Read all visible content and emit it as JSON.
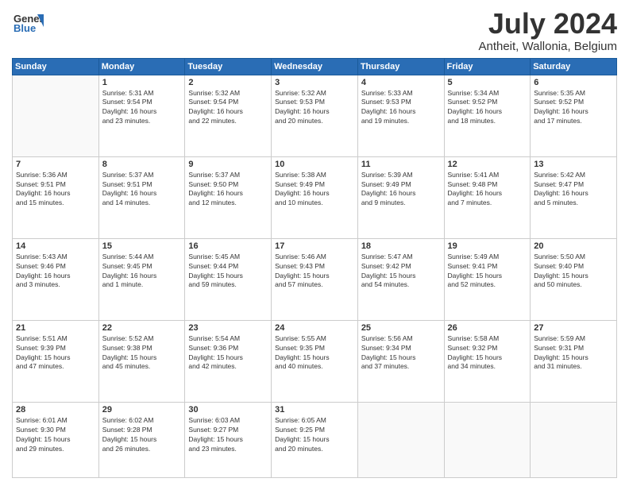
{
  "header": {
    "logo_line1": "General",
    "logo_line2": "Blue",
    "title": "July 2024",
    "subtitle": "Antheit, Wallonia, Belgium"
  },
  "weekdays": [
    "Sunday",
    "Monday",
    "Tuesday",
    "Wednesday",
    "Thursday",
    "Friday",
    "Saturday"
  ],
  "weeks": [
    [
      {
        "day": "",
        "info": ""
      },
      {
        "day": "1",
        "info": "Sunrise: 5:31 AM\nSunset: 9:54 PM\nDaylight: 16 hours\nand 23 minutes."
      },
      {
        "day": "2",
        "info": "Sunrise: 5:32 AM\nSunset: 9:54 PM\nDaylight: 16 hours\nand 22 minutes."
      },
      {
        "day": "3",
        "info": "Sunrise: 5:32 AM\nSunset: 9:53 PM\nDaylight: 16 hours\nand 20 minutes."
      },
      {
        "day": "4",
        "info": "Sunrise: 5:33 AM\nSunset: 9:53 PM\nDaylight: 16 hours\nand 19 minutes."
      },
      {
        "day": "5",
        "info": "Sunrise: 5:34 AM\nSunset: 9:52 PM\nDaylight: 16 hours\nand 18 minutes."
      },
      {
        "day": "6",
        "info": "Sunrise: 5:35 AM\nSunset: 9:52 PM\nDaylight: 16 hours\nand 17 minutes."
      }
    ],
    [
      {
        "day": "7",
        "info": "Sunrise: 5:36 AM\nSunset: 9:51 PM\nDaylight: 16 hours\nand 15 minutes."
      },
      {
        "day": "8",
        "info": "Sunrise: 5:37 AM\nSunset: 9:51 PM\nDaylight: 16 hours\nand 14 minutes."
      },
      {
        "day": "9",
        "info": "Sunrise: 5:37 AM\nSunset: 9:50 PM\nDaylight: 16 hours\nand 12 minutes."
      },
      {
        "day": "10",
        "info": "Sunrise: 5:38 AM\nSunset: 9:49 PM\nDaylight: 16 hours\nand 10 minutes."
      },
      {
        "day": "11",
        "info": "Sunrise: 5:39 AM\nSunset: 9:49 PM\nDaylight: 16 hours\nand 9 minutes."
      },
      {
        "day": "12",
        "info": "Sunrise: 5:41 AM\nSunset: 9:48 PM\nDaylight: 16 hours\nand 7 minutes."
      },
      {
        "day": "13",
        "info": "Sunrise: 5:42 AM\nSunset: 9:47 PM\nDaylight: 16 hours\nand 5 minutes."
      }
    ],
    [
      {
        "day": "14",
        "info": "Sunrise: 5:43 AM\nSunset: 9:46 PM\nDaylight: 16 hours\nand 3 minutes."
      },
      {
        "day": "15",
        "info": "Sunrise: 5:44 AM\nSunset: 9:45 PM\nDaylight: 16 hours\nand 1 minute."
      },
      {
        "day": "16",
        "info": "Sunrise: 5:45 AM\nSunset: 9:44 PM\nDaylight: 15 hours\nand 59 minutes."
      },
      {
        "day": "17",
        "info": "Sunrise: 5:46 AM\nSunset: 9:43 PM\nDaylight: 15 hours\nand 57 minutes."
      },
      {
        "day": "18",
        "info": "Sunrise: 5:47 AM\nSunset: 9:42 PM\nDaylight: 15 hours\nand 54 minutes."
      },
      {
        "day": "19",
        "info": "Sunrise: 5:49 AM\nSunset: 9:41 PM\nDaylight: 15 hours\nand 52 minutes."
      },
      {
        "day": "20",
        "info": "Sunrise: 5:50 AM\nSunset: 9:40 PM\nDaylight: 15 hours\nand 50 minutes."
      }
    ],
    [
      {
        "day": "21",
        "info": "Sunrise: 5:51 AM\nSunset: 9:39 PM\nDaylight: 15 hours\nand 47 minutes."
      },
      {
        "day": "22",
        "info": "Sunrise: 5:52 AM\nSunset: 9:38 PM\nDaylight: 15 hours\nand 45 minutes."
      },
      {
        "day": "23",
        "info": "Sunrise: 5:54 AM\nSunset: 9:36 PM\nDaylight: 15 hours\nand 42 minutes."
      },
      {
        "day": "24",
        "info": "Sunrise: 5:55 AM\nSunset: 9:35 PM\nDaylight: 15 hours\nand 40 minutes."
      },
      {
        "day": "25",
        "info": "Sunrise: 5:56 AM\nSunset: 9:34 PM\nDaylight: 15 hours\nand 37 minutes."
      },
      {
        "day": "26",
        "info": "Sunrise: 5:58 AM\nSunset: 9:32 PM\nDaylight: 15 hours\nand 34 minutes."
      },
      {
        "day": "27",
        "info": "Sunrise: 5:59 AM\nSunset: 9:31 PM\nDaylight: 15 hours\nand 31 minutes."
      }
    ],
    [
      {
        "day": "28",
        "info": "Sunrise: 6:01 AM\nSunset: 9:30 PM\nDaylight: 15 hours\nand 29 minutes."
      },
      {
        "day": "29",
        "info": "Sunrise: 6:02 AM\nSunset: 9:28 PM\nDaylight: 15 hours\nand 26 minutes."
      },
      {
        "day": "30",
        "info": "Sunrise: 6:03 AM\nSunset: 9:27 PM\nDaylight: 15 hours\nand 23 minutes."
      },
      {
        "day": "31",
        "info": "Sunrise: 6:05 AM\nSunset: 9:25 PM\nDaylight: 15 hours\nand 20 minutes."
      },
      {
        "day": "",
        "info": ""
      },
      {
        "day": "",
        "info": ""
      },
      {
        "day": "",
        "info": ""
      }
    ]
  ]
}
